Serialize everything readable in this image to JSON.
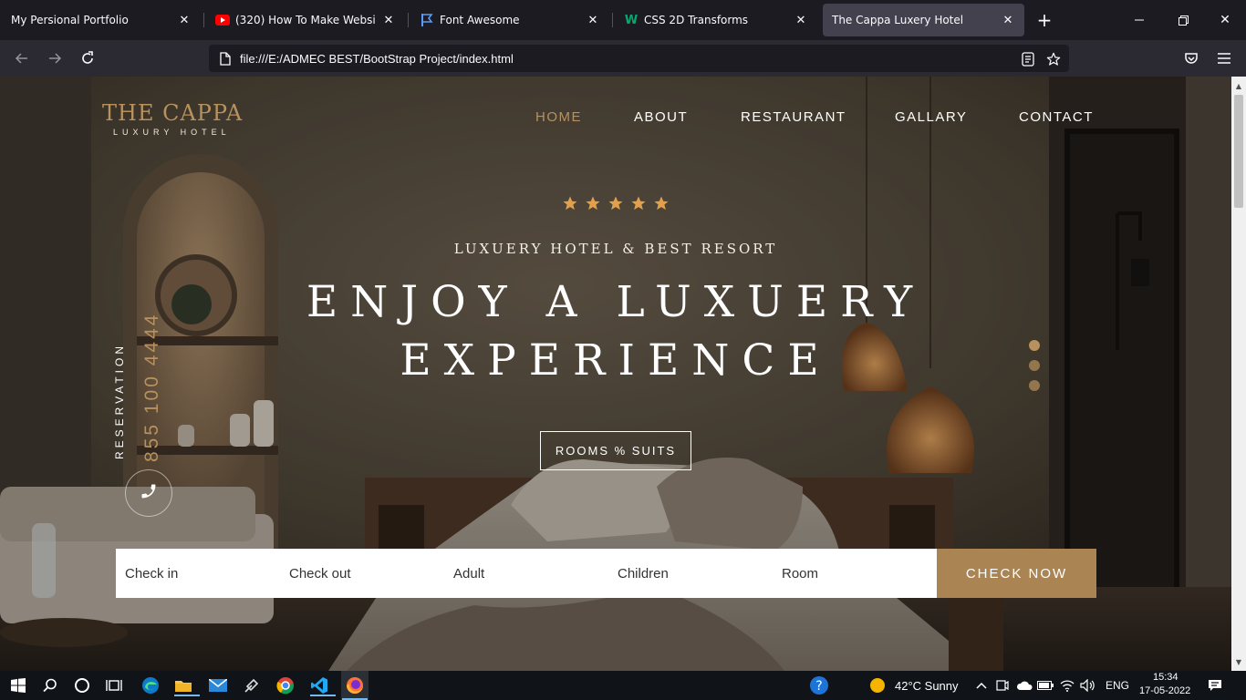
{
  "browser": {
    "tabs": [
      {
        "title": "My Persional Portfolio",
        "icon": "blank-page-icon",
        "active": false
      },
      {
        "title": "(320) How To Make Website Wi",
        "icon": "youtube-icon",
        "active": false
      },
      {
        "title": "Font Awesome",
        "icon": "flag-icon",
        "active": false
      },
      {
        "title": "CSS 2D Transforms",
        "icon": "w3schools-icon",
        "active": false
      },
      {
        "title": "The Cappa Luxery Hotel",
        "icon": "none",
        "active": true
      }
    ],
    "url": "file:///E:/ADMEC BEST/BootStrap Project/index.html"
  },
  "site": {
    "logo_main": "THE CAPPA",
    "logo_sub": "LUXURY HOTEL",
    "menu": [
      {
        "label": "HOME",
        "active": true
      },
      {
        "label": "ABOUT",
        "active": false
      },
      {
        "label": "RESTAURANT",
        "active": false
      },
      {
        "label": "GALLARY",
        "active": false
      },
      {
        "label": "CONTACT",
        "active": false
      }
    ],
    "rating_stars": 5,
    "kicker": "LUXUERY HOTEL & BEST RESORT",
    "headline_line1": "ENJOY A LUXUERY",
    "headline_line2": "EXPERIENCE",
    "cta_label": "ROOMS % SUITS",
    "reservation_label": "RESERVATION",
    "phone_number": "855 100 4444",
    "slider_dots": 3,
    "booking": {
      "fields": [
        "Check in",
        "Check out",
        "Adult",
        "Children",
        "Room"
      ],
      "button": "CHECK NOW"
    },
    "colors": {
      "accent": "#aa8453",
      "gold": "#b8925e",
      "star": "#e3a04b"
    }
  },
  "taskbar": {
    "weather": "42°C  Sunny",
    "lang": "ENG",
    "time": "15:34",
    "date": "17-05-2022"
  }
}
